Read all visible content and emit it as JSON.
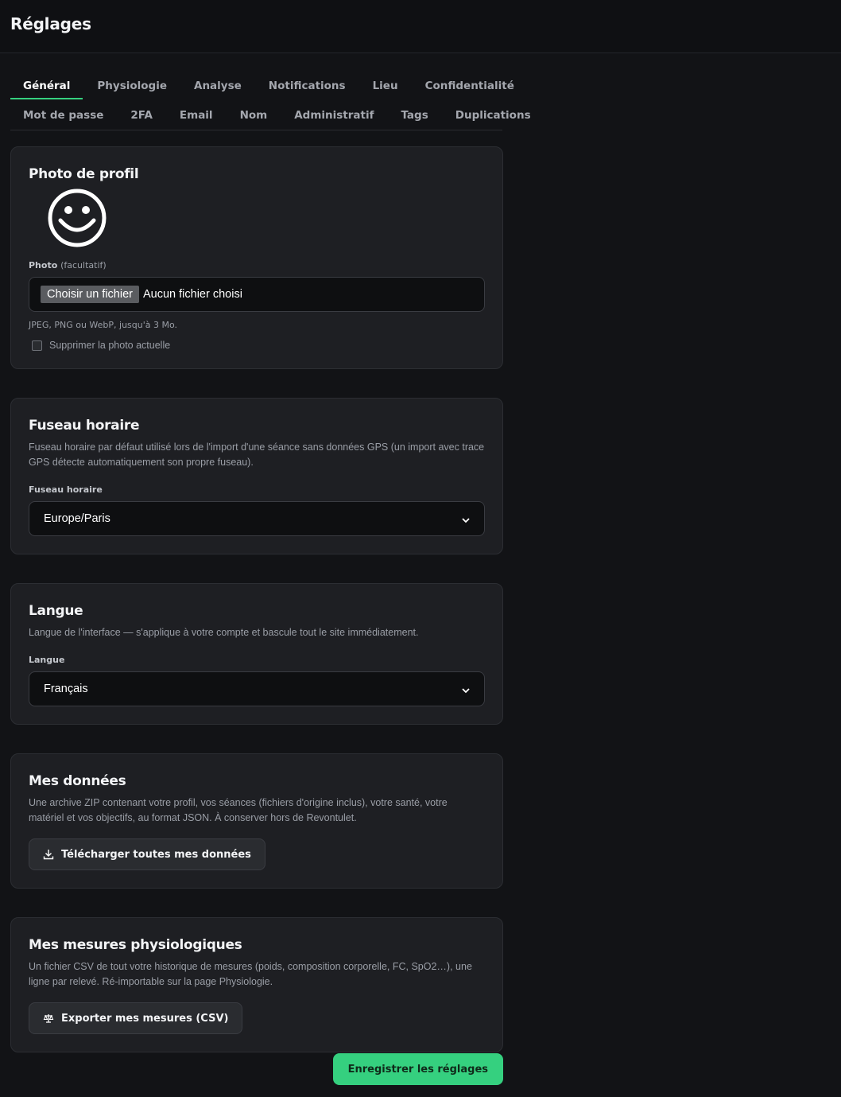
{
  "page_title": "Réglages",
  "tabs_row1": [
    "Général",
    "Physiologie",
    "Analyse",
    "Notifications",
    "Lieu",
    "Confidentialité"
  ],
  "tabs_row2": [
    "Mot de passe",
    "2FA",
    "Email",
    "Nom",
    "Administratif",
    "Tags",
    "Duplications"
  ],
  "active_tab": "Général",
  "profile_photo": {
    "title": "Photo de profil",
    "avatar_icon": "smiley-face-icon",
    "field_label": "Photo",
    "field_label_muted": "(facultatif)",
    "file_button": "Choisir un fichier",
    "file_status": "Aucun fichier choisi",
    "hint": "JPEG, PNG ou WebP, jusqu'à 3 Mo.",
    "remove_label": "Supprimer la photo actuelle"
  },
  "timezone": {
    "title": "Fuseau horaire",
    "description": "Fuseau horaire par défaut utilisé lors de l'import d'une séance sans données GPS (un import avec trace GPS détecte automatiquement son propre fuseau).",
    "field_label": "Fuseau horaire",
    "value": "Europe/Paris"
  },
  "language": {
    "title": "Langue",
    "description": "Langue de l'interface — s'applique à votre compte et bascule tout le site immédiatement.",
    "field_label": "Langue",
    "value": "Français"
  },
  "my_data": {
    "title": "Mes données",
    "description": "Une archive ZIP contenant votre profil, vos séances (fichiers d'origine inclus), votre santé, votre matériel et vos objectifs, au format JSON. À conserver hors de Revontulet.",
    "button": "Télécharger toutes mes données"
  },
  "measures": {
    "title": "Mes mesures physiologiques",
    "description": "Un fichier CSV de tout votre historique de mesures (poids, composition corporelle, FC, SpO2…), une ligne par relevé. Ré-importable sur la page Physiologie.",
    "button": "Exporter mes mesures (CSV)"
  },
  "save_button": "Enregistrer les réglages",
  "colors": {
    "accent": "#35d07f",
    "background": "#121316",
    "card": "#1e1f23"
  }
}
